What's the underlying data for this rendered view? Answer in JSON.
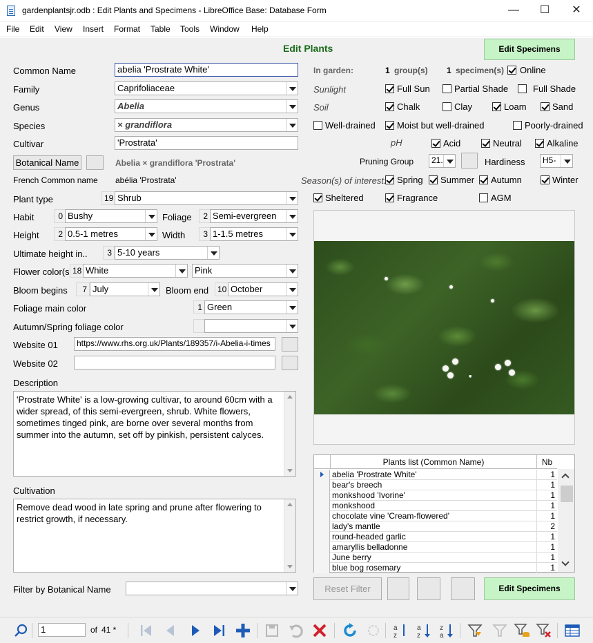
{
  "window": {
    "title": "gardenplantsjr.odb : Edit Plants and Specimens - LibreOffice Base: Database Form",
    "minimize": "—",
    "maximize": "☐",
    "close": "✕"
  },
  "menu": [
    "File",
    "Edit",
    "View",
    "Insert",
    "Format",
    "Table",
    "Tools",
    "Window",
    "Help"
  ],
  "form": {
    "heading": "Edit Plants",
    "edit_specimens_top": "Edit Specimens",
    "common_name": {
      "label": "Common Name",
      "value": "abelia 'Prostrate White'"
    },
    "family": {
      "label": "Family",
      "value": "Caprifoliaceae"
    },
    "genus": {
      "label": "Genus",
      "value": "Abelia"
    },
    "species": {
      "label": "Species",
      "value": "× grandiflora"
    },
    "cultivar": {
      "label": "Cultivar",
      "value": "'Prostrata'"
    },
    "botanical_name": {
      "button": "Botanical Name",
      "value": "Abelia × grandiflora 'Prostrata'"
    },
    "french": {
      "label": "French Common name",
      "value": "abélia 'Prostrata'"
    },
    "plant_type": {
      "label": "Plant type",
      "num": "19",
      "value": "Shrub"
    },
    "habit": {
      "label": "Habit",
      "num": "0",
      "value": "Bushy"
    },
    "foliage": {
      "label": "Foliage",
      "num": "2",
      "value": "Semi-evergreen"
    },
    "height": {
      "label": "Height",
      "num": "2",
      "value": "0.5-1 metres"
    },
    "width": {
      "label": "Width",
      "num": "3",
      "value": "1-1.5 metres"
    },
    "ultimate": {
      "label": "Ultimate height in..",
      "num": "3",
      "value": "5-10 years"
    },
    "flower_color": {
      "label": "Flower color(s)",
      "num": "18",
      "value": "White",
      "value2": "Pink"
    },
    "bloom_begins": {
      "label": "Bloom begins",
      "num": "7",
      "value": "July"
    },
    "bloom_end": {
      "label": "Bloom end",
      "num": "10",
      "value": "October"
    },
    "foliage_main": {
      "label": "Foliage main color",
      "num": "1",
      "value": "Green"
    },
    "autumn_color": {
      "label": "Autumn/Spring foliage color",
      "num": "",
      "value": ""
    },
    "website01": {
      "label": "Website 01",
      "value": "https://www.rhs.org.uk/Plants/189357/i-Abelia-i-times"
    },
    "website02": {
      "label": "Website 02",
      "value": ""
    },
    "description": {
      "label": "Description",
      "value": "'Prostrate White' is a low-growing cultivar, to around 60cm with a wider spread, of this semi-evergreen, shrub. White flowers, sometimes tinged pink, are borne over several months from summer into the autumn, set off by pinkish, persistent calyces."
    },
    "cultivation": {
      "label": "Cultivation",
      "value": "Remove dead wood in late spring and prune after flowering to restrict growth, if necessary."
    },
    "filter": {
      "label": "Filter by Botanical Name",
      "value": ""
    },
    "in_garden": {
      "label": "In garden:",
      "groups_n": "1",
      "groups": "group(s)",
      "specimens_n": "1",
      "specimens": "specimen(s)",
      "online": "Online"
    },
    "sunlight": {
      "label": "Sunlight",
      "full_sun": "Full Sun",
      "partial": "Partial Shade",
      "full_shade": "Full Shade"
    },
    "soil": {
      "label": "Soil",
      "chalk": "Chalk",
      "clay": "Clay",
      "loam": "Loam",
      "sand": "Sand"
    },
    "drain": {
      "well": "Well-drained",
      "moist": "Moist but well-drained",
      "poorly": "Poorly-drained"
    },
    "ph": {
      "label": "pH",
      "acid": "Acid",
      "neutral": "Neutral",
      "alkaline": "Alkaline"
    },
    "pruning": {
      "label": "Pruning Group",
      "value": "21.-"
    },
    "hardiness": {
      "label": "Hardiness",
      "value": "H5-"
    },
    "seasons": {
      "label": "Season(s) of interest:",
      "spring": "Spring",
      "summer": "Summer",
      "autumn": "Autumn",
      "winter": "Winter"
    },
    "misc": {
      "sheltered": "Sheltered",
      "fragrance": "Fragrance",
      "agm": "AGM"
    },
    "reset_filter": "Reset Filter",
    "edit_specimens_bottom": "Edit Specimens"
  },
  "plants_list": {
    "header_name": "Plants list (Common Name)",
    "header_nb": "Nb",
    "rows": [
      {
        "name": "abelia 'Prostrate White'",
        "nb": "1"
      },
      {
        "name": "bear's breech",
        "nb": "1"
      },
      {
        "name": "monkshood 'Ivorine'",
        "nb": "1"
      },
      {
        "name": "monkshood",
        "nb": "1"
      },
      {
        "name": "chocolate vine 'Cream-flowered'",
        "nb": "1"
      },
      {
        "name": "lady's mantle",
        "nb": "2"
      },
      {
        "name": "round-headed garlic",
        "nb": "1"
      },
      {
        "name": "amaryllis belladonne",
        "nb": "1"
      },
      {
        "name": "June berry",
        "nb": "1"
      },
      {
        "name": "blue bog rosemary",
        "nb": "1"
      }
    ]
  },
  "nav": {
    "record": "1",
    "of": "of",
    "total": "41 *"
  },
  "colors": {
    "heading": "#1b6b1b",
    "green_button": "#c6f4c6",
    "link_blue": "#1e5bb8"
  }
}
